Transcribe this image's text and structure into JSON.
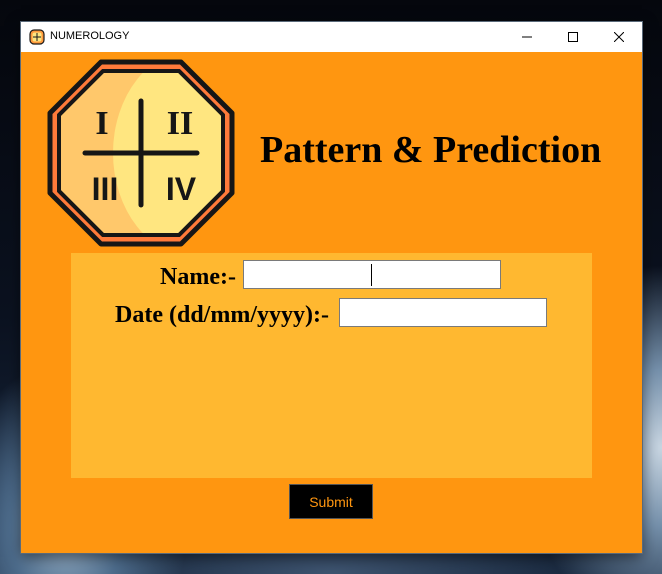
{
  "window": {
    "title": "NUMEROLOGY",
    "controls": {
      "minimize_icon": "minimize-icon",
      "maximize_icon": "maximize-icon",
      "close_icon": "close-icon"
    }
  },
  "header": {
    "title": "Pattern & Prediction",
    "logo": {
      "icon": "roman-numerals-clock-icon",
      "numerals": [
        "I",
        "II",
        "III",
        "IV"
      ]
    }
  },
  "form": {
    "name_label": "Name:-",
    "name_value": "",
    "date_label": "Date (dd/mm/yyyy):-",
    "date_value": ""
  },
  "actions": {
    "submit_label": "Submit"
  },
  "colors": {
    "background": "#ff9610",
    "panel": "#ffb830",
    "button_bg": "#000000",
    "button_text": "#ff9610",
    "logo_border": "#ff7a3a",
    "logo_fill": "#ffc86b",
    "logo_highlight": "#ffe680"
  }
}
